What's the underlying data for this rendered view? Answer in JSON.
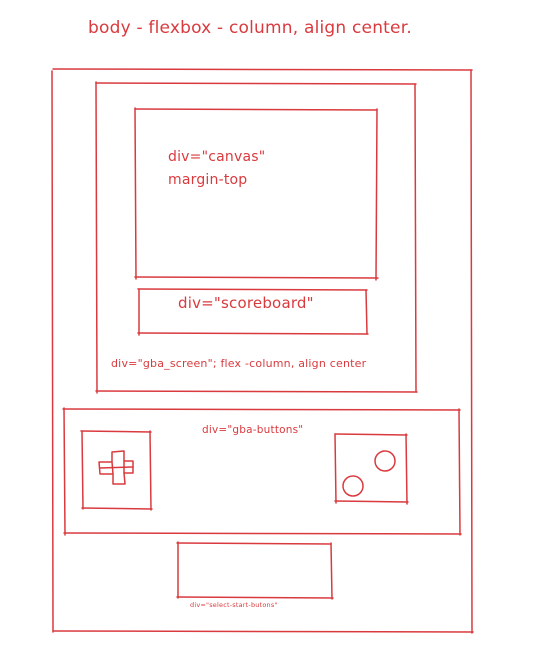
{
  "title": "body - flexbox - column, align center.",
  "labels": {
    "canvas_line1": "div=\"canvas\"",
    "canvas_line2": "margin-top",
    "scoreboard": "div=\"scoreboard\"",
    "gba_screen": "div=\"gba_screen\"; flex -column, align center",
    "gba_buttons": "div=\"gba-buttons\"",
    "select_start": "div=\"select-start-butons\""
  },
  "colors": {
    "ink": "#d93a3e"
  }
}
